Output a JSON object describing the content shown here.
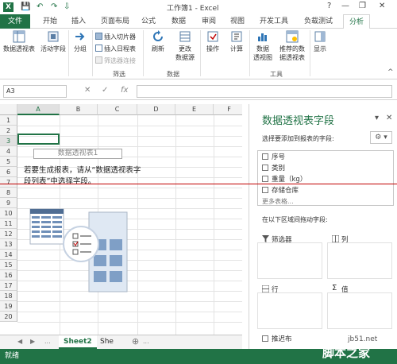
{
  "window": {
    "title": "工作簿1 - Excel",
    "help_label": "?",
    "min_label": "—",
    "restore_label": "❐",
    "close_label": "✕"
  },
  "quick_access": {
    "save": "💾",
    "undo": "↶",
    "redo": "↷",
    "more": "⇩"
  },
  "tabs": [
    {
      "label": "文件"
    },
    {
      "label": "开始"
    },
    {
      "label": "插入"
    },
    {
      "label": "页面布局"
    },
    {
      "label": "公式"
    },
    {
      "label": "数据"
    },
    {
      "label": "审阅"
    },
    {
      "label": "视图"
    },
    {
      "label": "开发工具"
    },
    {
      "label": "负载测试"
    },
    {
      "label": "分析"
    }
  ],
  "ribbon": {
    "pivot_table": "数据透视表",
    "active_field": "活动字段",
    "group": "分组",
    "insert_slicer": "插入切片器",
    "insert_timeline": "插入日程表",
    "filter_connections": "筛选器连接",
    "filter_group": "筛选",
    "refresh": "刷新",
    "change_source_1": "更改",
    "change_source_2": "数据源",
    "data_group": "数据",
    "actions": "操作",
    "calculations": "计算",
    "pivot_chart_1": "数据",
    "pivot_chart_2": "透视图",
    "recommended_1": "推荐的数",
    "recommended_2": "据透视表",
    "tools_group": "工具",
    "show": "显示",
    "collapse": "^"
  },
  "formula_bar": {
    "name_box": "A3",
    "cancel": "✕",
    "enter": "✓",
    "fx": "fx",
    "value": ""
  },
  "grid": {
    "columns": [
      "A",
      "B",
      "C",
      "D",
      "E",
      "F"
    ],
    "rows": [
      "1",
      "2",
      "3",
      "4",
      "5",
      "6",
      "7",
      "8",
      "9",
      "10",
      "11",
      "12",
      "13",
      "14",
      "15",
      "16",
      "17",
      "18",
      "19",
      "20"
    ],
    "pivot_placeholder": "数据透视表1",
    "hint_text": "若要生成报表，请从“数据透视表字段列表”中选择字段。"
  },
  "sheet_tabs": {
    "nav_prev": "◀",
    "nav_next": "▶",
    "ellipsis": "...",
    "tabs": [
      "Sheet2",
      "She"
    ],
    "add": "⊕"
  },
  "status": "就绪",
  "field_pane": {
    "title": "数据透视表字段",
    "pin": "▾",
    "close": "✕",
    "subtitle": "选择要添加到报表的字段:",
    "gear": "⚙ ▾",
    "fields": [
      "序号",
      "类别",
      "重量（kg）",
      "存储仓库"
    ],
    "more_tables": "更多表格...",
    "drag_hint": "在以下区域间拖动字段:",
    "areas": {
      "filters": "筛选器",
      "columns": "列",
      "rows": "行",
      "values": "值"
    },
    "defer_update": "推迟布"
  },
  "watermark": {
    "line1": "jb51.net",
    "line2": "脚本之家"
  },
  "colors": {
    "excel_green": "#217346",
    "red_line": "#c00000"
  }
}
